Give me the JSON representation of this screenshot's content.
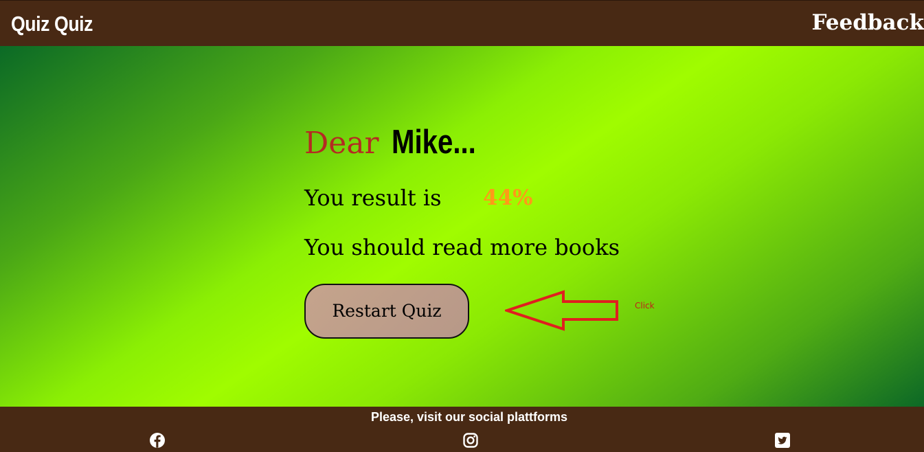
{
  "header": {
    "brand": "Quiz Quiz",
    "nav_link": "Feedback"
  },
  "result": {
    "greeting_word": "Dear",
    "user_name": "Mike...",
    "label": "You result is",
    "score": "44%",
    "score_percent": 44,
    "advice": "You should read more books"
  },
  "actions": {
    "restart_label": "Restart Quiz",
    "click_note": "Click"
  },
  "footer": {
    "text": "Please, visit our social plattforms",
    "social": [
      {
        "icon": "facebook-icon"
      },
      {
        "icon": "instagram-icon"
      },
      {
        "icon": "twitter-icon"
      }
    ]
  },
  "colors": {
    "bar": "#482914",
    "greeting_word": "#b52a22",
    "score": "#ff9a18",
    "gradient_mid": "#a0fc00",
    "gradient_edge": "#0b6a26",
    "arrow": "#e01f1f"
  }
}
